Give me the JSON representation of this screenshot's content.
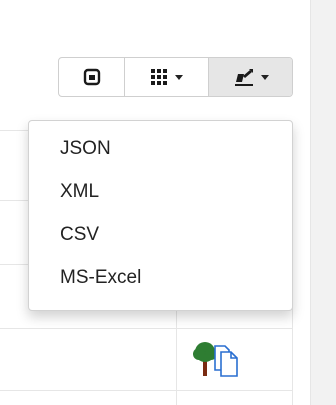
{
  "toolbar": {
    "buttons": [
      {
        "icon": "toggle-view-icon"
      },
      {
        "icon": "columns-grid-icon"
      },
      {
        "icon": "export-icon"
      }
    ]
  },
  "export_menu": {
    "items": [
      {
        "label": "JSON"
      },
      {
        "label": "XML"
      },
      {
        "label": "CSV"
      },
      {
        "label": "MS-Excel"
      }
    ]
  },
  "colors": {
    "active_button_bg": "#e6e6e6",
    "border": "#cfcfcf",
    "tree_green": "#2e7d32",
    "tree_trunk": "#7a2b12",
    "doc_blue": "#2a6fd1"
  }
}
